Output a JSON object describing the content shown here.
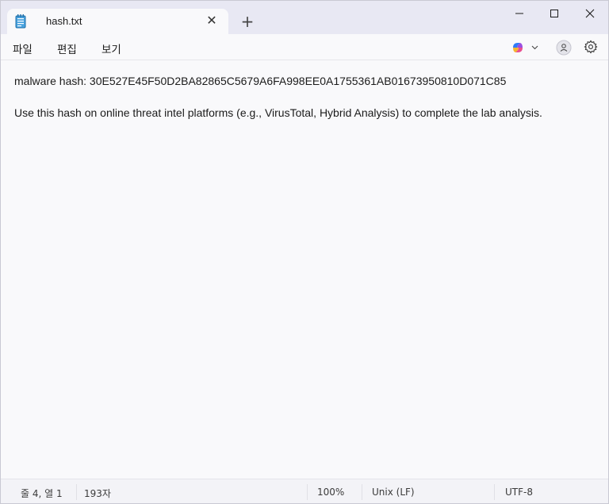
{
  "window": {
    "tab_title": "hash.txt",
    "tab_close_glyph": "✕",
    "new_tab_glyph": "+"
  },
  "menu": {
    "file": "파일",
    "edit": "편집",
    "view": "보기"
  },
  "toolbar_icons": [
    "copilot-icon",
    "chevron-down-icon",
    "account-icon",
    "gear-icon"
  ],
  "editor": {
    "lines": [
      "malware hash: 30E527E45F50D2BA82865C5679A6FA998EE0A1755361AB01673950810D071C85",
      "",
      "Use this hash on online threat intel platforms (e.g., VirusTotal, Hybrid Analysis) to complete the lab analysis."
    ]
  },
  "status": {
    "position": "줄 4, 열 1",
    "char_count": "193자",
    "zoom": "100%",
    "line_ending": "Unix (LF)",
    "encoding": "UTF-8"
  }
}
